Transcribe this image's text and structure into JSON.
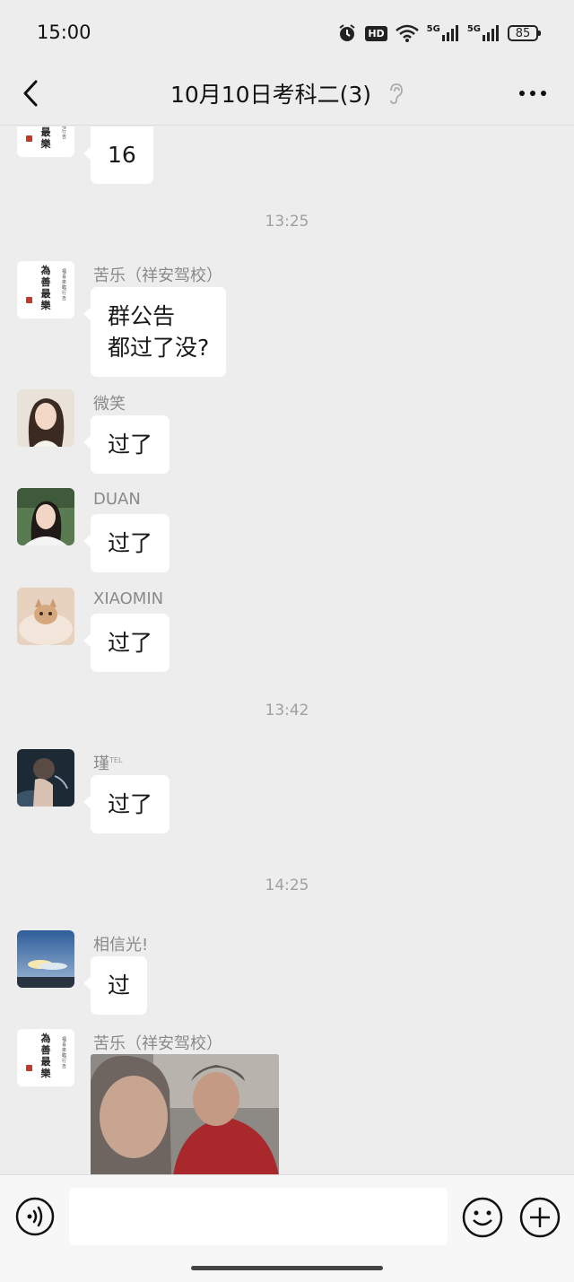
{
  "status_bar": {
    "time": "15:00",
    "hd_label": "HD",
    "net1": "5G",
    "net2": "5G",
    "battery": "85",
    "icons": [
      "alarm-icon",
      "hd-icon",
      "wifi-icon",
      "signal-icon",
      "signal-icon",
      "battery-icon"
    ]
  },
  "nav": {
    "title": "10月10日考科二(3)",
    "icons": [
      "back-arrow-icon",
      "ear-icon",
      "more-icon"
    ]
  },
  "messages": [
    {
      "type": "text",
      "sender": "",
      "text": "16",
      "avatar": "seal-calligraphy"
    },
    {
      "type": "time",
      "text": "13:25"
    },
    {
      "type": "text",
      "sender": "苦乐（祥安驾校）",
      "text": "群公告\n都过了没?",
      "avatar": "seal-calligraphy"
    },
    {
      "type": "text",
      "sender": "微笑",
      "text": "过了",
      "avatar": "portrait-1"
    },
    {
      "type": "text",
      "sender": "DUAN",
      "text": "过了",
      "avatar": "portrait-2"
    },
    {
      "type": "text",
      "sender": "XIAOMIN",
      "text": "过了",
      "avatar": "cat"
    },
    {
      "type": "time",
      "text": "13:42"
    },
    {
      "type": "text",
      "sender": "瑾",
      "sender_sup": "TEL",
      "text": "过了",
      "avatar": "dark-portrait"
    },
    {
      "type": "time",
      "text": "14:25"
    },
    {
      "type": "text",
      "sender": "相信光!",
      "text": "过",
      "avatar": "sky"
    },
    {
      "type": "image",
      "sender": "苦乐（祥安驾校）",
      "avatar": "seal-calligraphy"
    }
  ],
  "seal_avatar": {
    "calligraphy": "為善最樂",
    "side_text": "福喜來臨行吉"
  },
  "input": {
    "placeholder": "",
    "value": "",
    "icons": [
      "voice-icon",
      "emoji-icon",
      "plus-icon"
    ]
  },
  "colors": {
    "background": "#ededed",
    "bubble": "#ffffff",
    "timestamp": "#a0a0a0",
    "sender": "#8a8a8a",
    "input_bar": "#f7f7f7"
  }
}
